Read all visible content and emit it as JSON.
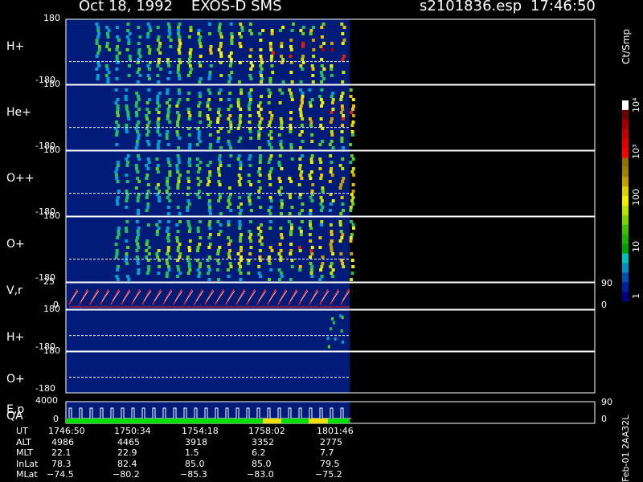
{
  "header": {
    "title": "Oct 18, 1992    EXOS-D SMS",
    "file": "s2101836.esp",
    "time": "17:46:50"
  },
  "colorbar": {
    "unit_label": "Ct/Smp",
    "tick_labels": [
      "10⁴",
      "10³",
      "100",
      "10",
      "1"
    ]
  },
  "side_label": "Feb-01 2AA32L",
  "chart_data": [
    {
      "type": "heatmap",
      "panel": "H+ (upper)",
      "label": "H+",
      "ylim": [
        -180,
        180
      ],
      "tick_top": "180",
      "tick_bottom": "-180"
    },
    {
      "type": "heatmap",
      "panel": "He+",
      "label": "He+",
      "ylim": [
        -180,
        180
      ],
      "tick_top": "180",
      "tick_bottom": "-180"
    },
    {
      "type": "heatmap",
      "panel": "O++",
      "label": "O++",
      "ylim": [
        -180,
        180
      ],
      "tick_top": "180",
      "tick_bottom": "-180"
    },
    {
      "type": "heatmap",
      "panel": "O+ (upper)",
      "label": "O+",
      "ylim": [
        -180,
        180
      ],
      "tick_top": "180",
      "tick_bottom": "-180"
    },
    {
      "type": "line",
      "panel": "V,r",
      "label": "V,r",
      "left_ticks": [
        "25",
        "0"
      ],
      "right_ticks": [
        "90",
        "0"
      ]
    },
    {
      "type": "heatmap",
      "panel": "H+ (lower)",
      "label": "H+",
      "ylim": [
        -180,
        180
      ],
      "tick_top": "180",
      "tick_bottom": "-180"
    },
    {
      "type": "heatmap",
      "panel": "O+ (lower)",
      "label": "O+",
      "ylim": [
        -180,
        180
      ],
      "tick_top": "180",
      "tick_bottom": "-180"
    },
    {
      "type": "line",
      "panel": "E,p QA",
      "label": "E,p",
      "label2": "QA",
      "left_ticks": [
        "4000",
        "0"
      ],
      "right_ticks": [
        "90",
        "0"
      ],
      "qa_colors": [
        "#00e000",
        "#f0e000"
      ]
    }
  ],
  "ephemeris": {
    "row_labels": [
      "UT",
      "ALT",
      "MLT",
      "InLat",
      "MLat"
    ],
    "columns": [
      [
        "1746:50",
        "4986",
        "22.1",
        "78.3",
        "−74.5"
      ],
      [
        "1750:34",
        "4465",
        "22.9",
        "82.4",
        "−80.2"
      ],
      [
        "1754:18",
        "3918",
        "1.5",
        "85.0",
        "−85.3"
      ],
      [
        "1758:02",
        "3352",
        "6.2",
        "85.0",
        "−83.0"
      ],
      [
        "1801:46",
        "2775",
        "7.7",
        "79.5",
        "−75.2"
      ]
    ]
  }
}
